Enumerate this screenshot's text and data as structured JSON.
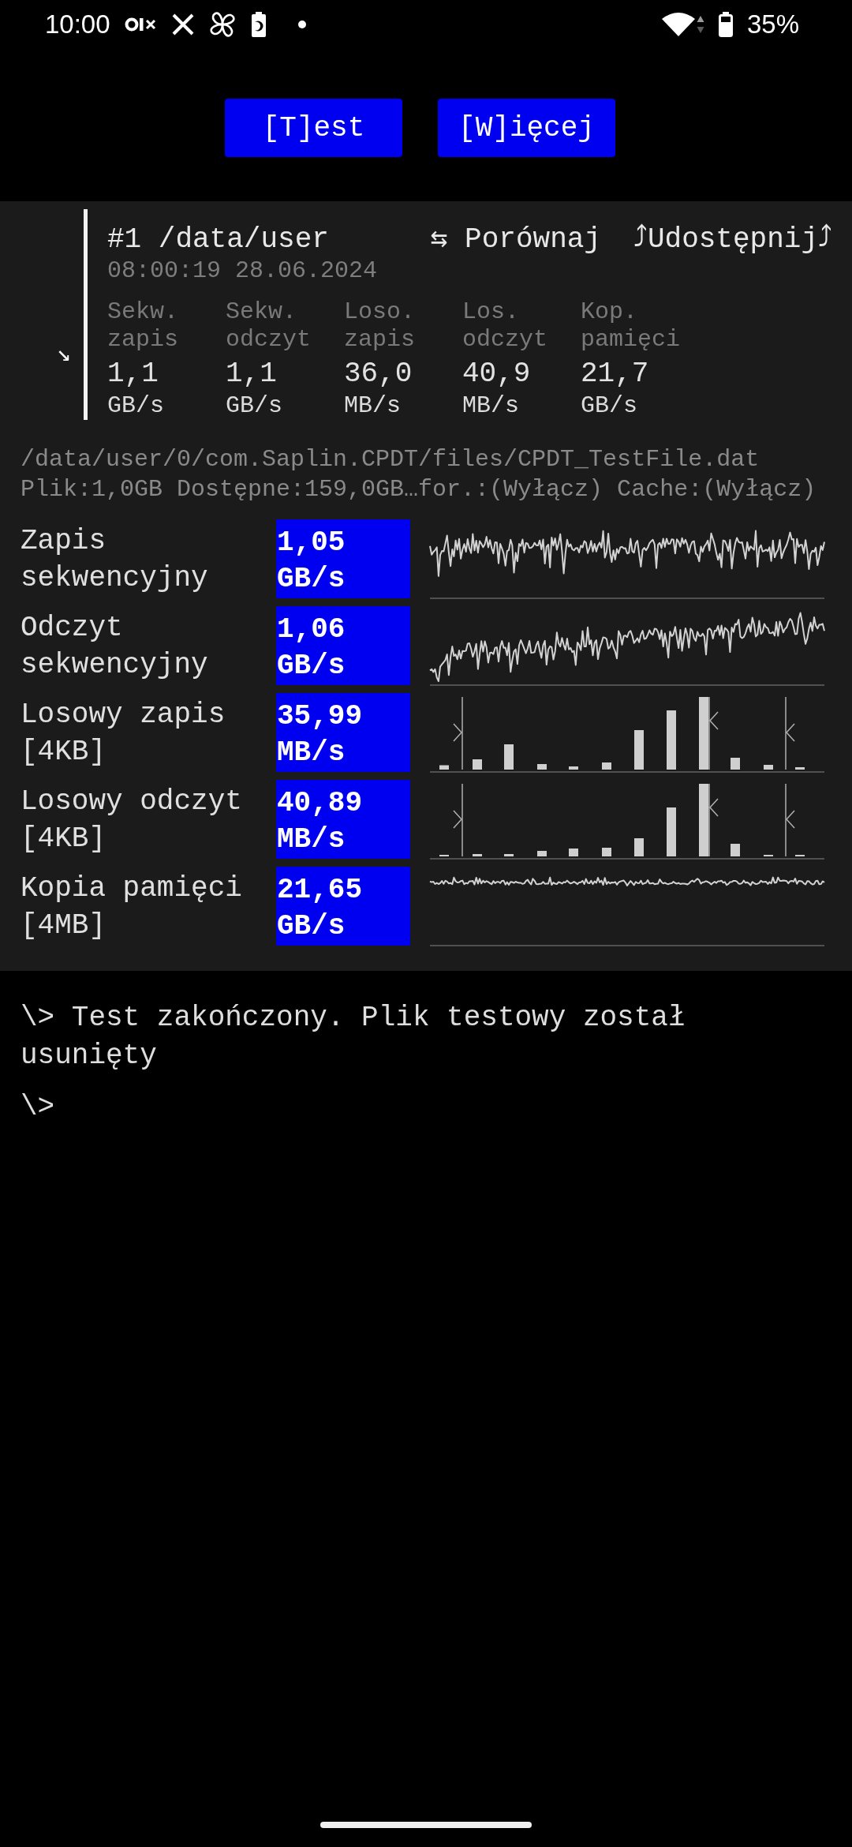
{
  "status_bar": {
    "time": "10:00",
    "battery": "35%"
  },
  "buttons": [
    {
      "label": "[T]est"
    },
    {
      "label": "[W]ięcej"
    }
  ],
  "result": {
    "toggle": "↘",
    "title": "#1 /data/user",
    "actions": [
      {
        "label": "⇆ Porównaj"
      },
      {
        "label": "⤴Udostępnij⤴"
      }
    ],
    "timestamp": "08:00:19 28.06.2024",
    "metrics": [
      {
        "label": "Sekw. zapis",
        "value": "1,1",
        "unit": "GB/s"
      },
      {
        "label": "Sekw. odczyt",
        "value": "1,1",
        "unit": "GB/s"
      },
      {
        "label": "Loso. zapis",
        "value": "36,0",
        "unit": "MB/s"
      },
      {
        "label": "Los. odczyt",
        "value": "40,9",
        "unit": "MB/s"
      },
      {
        "label": "Kop. pamięci",
        "value": "21,7",
        "unit": "GB/s"
      }
    ]
  },
  "file": {
    "path": "/data/user/0/com.Saplin.CPDT/files/CPDT_TestFile.dat",
    "info": "Plik:1,0GB Dostępne:159,0GB…for.:(Wyłącz) Cache:(Wyłącz)"
  },
  "tests": [
    {
      "name": "Zapis sekwencyjny",
      "speed": "1,05 GB/s",
      "kind": "trace"
    },
    {
      "name": "Odczyt sekwencyjny",
      "speed": "1,06 GB/s",
      "kind": "trace"
    },
    {
      "name": "Losowy zapis [4KB]",
      "speed": "35,99 MB/s",
      "kind": "histogram"
    },
    {
      "name": "Losowy odczyt [4KB]",
      "speed": "40,89 MB/s",
      "kind": "histogram"
    },
    {
      "name": "Kopia pamięci [4MB]",
      "speed": "21,65 GB/s",
      "kind": "trace"
    }
  ],
  "console": [
    "\\> Test zakończony. Plik testowy został usunięty",
    "\\>"
  ]
}
